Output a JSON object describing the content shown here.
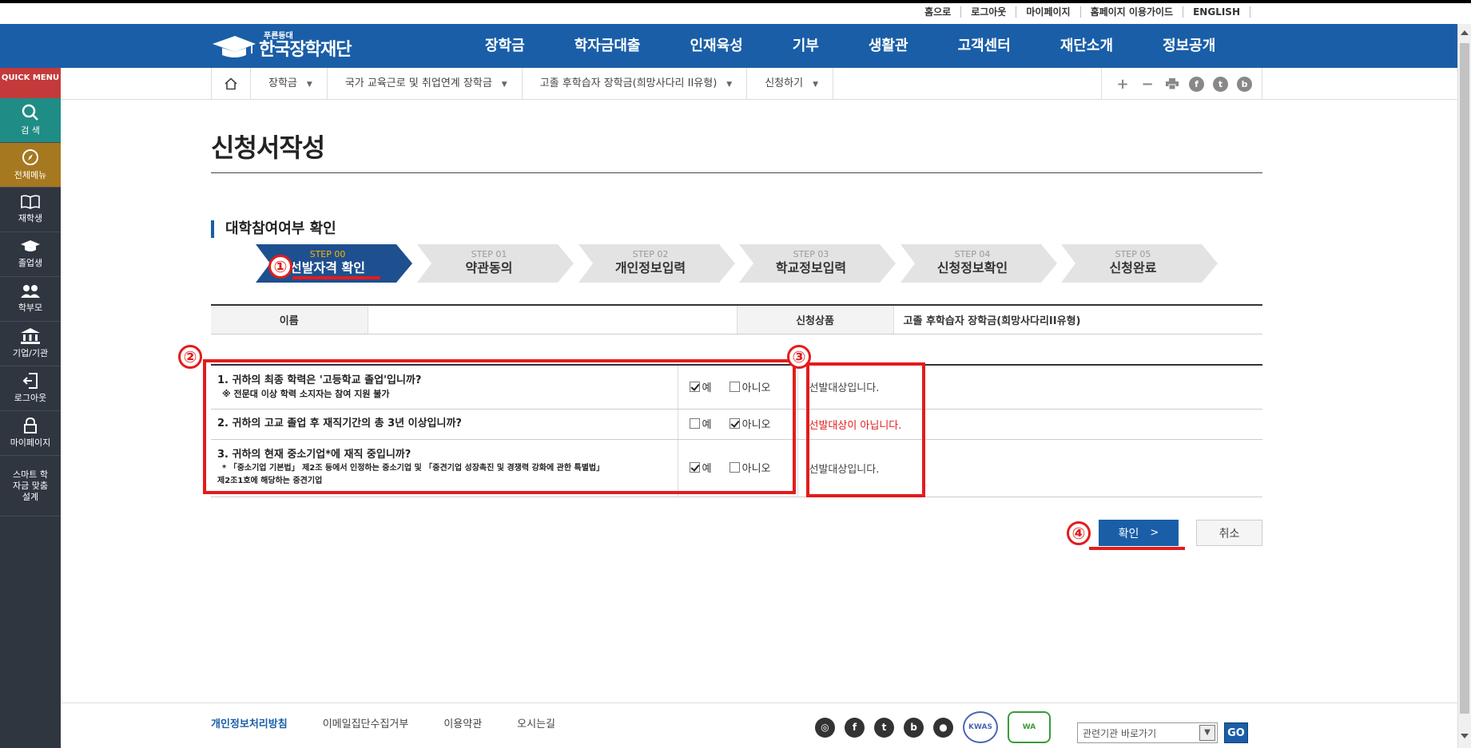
{
  "topbar": {
    "links": [
      "홈으로",
      "로그아웃",
      "마이페이지",
      "홈페이지 이용가이드",
      "ENGLISH"
    ]
  },
  "header": {
    "logo_small": "푸른등대",
    "logo_big": "한국장학재단",
    "menu": [
      "장학금",
      "학자금대출",
      "인재육성",
      "기부",
      "생활관",
      "고객센터",
      "재단소개",
      "정보공개"
    ]
  },
  "breadcrumb": {
    "items": [
      "장학금",
      "국가 교육근로 및 취업연계 장학금",
      "고졸 후학습자 장학금(희망사다리 II유형)",
      "신청하기"
    ]
  },
  "tools": {
    "zoom_in": "+",
    "zoom_out": "−",
    "sns": [
      "f",
      "t",
      "b"
    ]
  },
  "quick_menu": {
    "head": "QUICK MENU",
    "items": [
      "검 색",
      "전체메뉴",
      "재학생",
      "졸업생",
      "학부모",
      "기업/기관",
      "로그아웃",
      "마이페이지"
    ],
    "smart": "스마트 학자금 맞춤설계"
  },
  "page": {
    "title": "신청서작성",
    "section_title": "대학참여여부 확인"
  },
  "steps": [
    {
      "num": "STEP 00",
      "name": "선발자격 확인",
      "active": true
    },
    {
      "num": "STEP 01",
      "name": "약관동의",
      "active": false
    },
    {
      "num": "STEP 02",
      "name": "개인정보입력",
      "active": false
    },
    {
      "num": "STEP 03",
      "name": "학교정보입력",
      "active": false
    },
    {
      "num": "STEP 04",
      "name": "신청정보확인",
      "active": false
    },
    {
      "num": "STEP 05",
      "name": "신청완료",
      "active": false
    }
  ],
  "info": {
    "name_label": "이름",
    "name_value": "",
    "product_label": "신청상품",
    "product_value": "고졸 후학습자 장학금(희망사다리II유형)"
  },
  "questions": [
    {
      "text": "1. 귀하의 최종 학력은 '고등학교 졸업'입니까?",
      "note": "※ 전문대 이상 학력 소지자는 참여 지원 불가",
      "yes_label": "예",
      "no_label": "아니오",
      "yes_checked": true,
      "no_checked": false,
      "result": "선발대상입니다.",
      "result_ok": true
    },
    {
      "text": "2. 귀하의 고교 졸업 후 재직기간의 총 3년 이상입니까?",
      "note": "",
      "yes_label": "예",
      "no_label": "아니오",
      "yes_checked": false,
      "no_checked": true,
      "result": "선발대상이 아닙니다.",
      "result_ok": false
    },
    {
      "text": "3. 귀하의 현재 중소기업*에 재직 중입니까?",
      "note": "* 「중소기업 기본법」 제2조 등에서 인정하는 중소기업 및 「중견기업 성장촉진 및 경쟁력 강화에 관한 특별법」",
      "note2": "제2조1호에 해당하는 중견기업",
      "yes_label": "예",
      "no_label": "아니오",
      "yes_checked": true,
      "no_checked": false,
      "result": "선발대상입니다.",
      "result_ok": true
    }
  ],
  "buttons": {
    "confirm": "확인",
    "cancel": "취소"
  },
  "annotations": [
    "①",
    "②",
    "③",
    "④"
  ],
  "footer": {
    "links": [
      "개인정보처리방침",
      "이메일집단수집거부",
      "이용약관",
      "오시는길"
    ],
    "sns": [
      "◎",
      "f",
      "t",
      "b",
      "●"
    ],
    "seal1": "KWAS",
    "seal2": "WA",
    "related_placeholder": "관련기관 바로가기",
    "go": "GO"
  },
  "colors": {
    "brand": "#1a5ea8",
    "annotation": "#e31c1c",
    "error_text": "#e21b1b"
  }
}
